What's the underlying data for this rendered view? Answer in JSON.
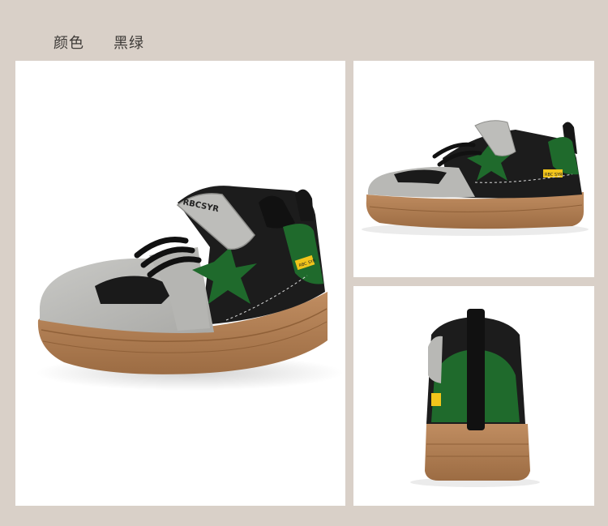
{
  "header": {
    "color_label": "颜色",
    "color_value": "黑绿"
  },
  "product": {
    "brand_text": "RBCSYR",
    "tag_text": "RBC SYR"
  },
  "colors": {
    "background": "#d9d0c8",
    "upper_grey": "#b9b9b6",
    "accent_green": "#1f6a2c",
    "black": "#1a1a1a",
    "sole_gum": "#b07e52",
    "tag_yellow": "#f2c51b"
  }
}
